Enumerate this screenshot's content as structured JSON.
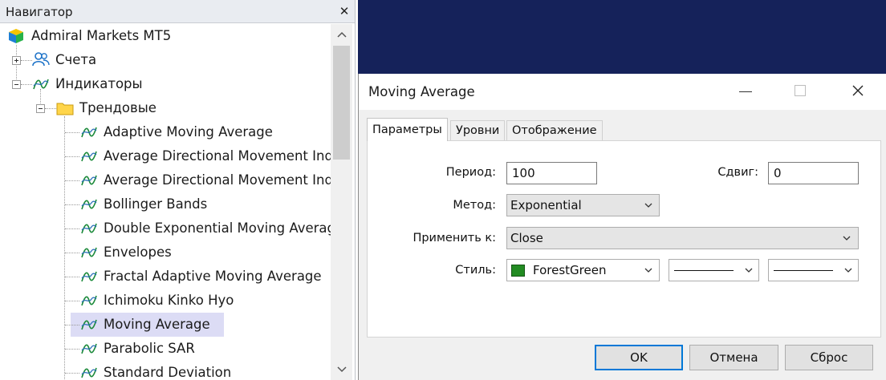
{
  "navigator": {
    "title": "Навигатор",
    "close_glyph": "✕",
    "root": {
      "label": "Admiral Markets MT5",
      "icon": "admiral-logo-icon"
    },
    "accounts": {
      "label": "Счета",
      "icon": "accounts-icon"
    },
    "indicators": {
      "label": "Индикаторы",
      "icon": "indicator-icon"
    },
    "trend_folder": {
      "label": "Трендовые",
      "icon": "folder-icon"
    },
    "items": [
      {
        "label": "Adaptive Moving Average"
      },
      {
        "label": "Average Directional Movement Inde"
      },
      {
        "label": "Average Directional Movement Inde"
      },
      {
        "label": "Bollinger Bands"
      },
      {
        "label": "Double Exponential Moving Average"
      },
      {
        "label": "Envelopes"
      },
      {
        "label": "Fractal Adaptive Moving Average"
      },
      {
        "label": "Ichimoku Kinko Hyo"
      },
      {
        "label": "Moving Average"
      },
      {
        "label": "Parabolic SAR"
      },
      {
        "label": "Standard Deviation"
      }
    ],
    "selected_item": "Moving Average"
  },
  "dialog": {
    "title": "Moving Average",
    "tabs": [
      {
        "label": "Параметры",
        "active": true
      },
      {
        "label": "Уровни",
        "active": false
      },
      {
        "label": "Отображение",
        "active": false
      }
    ],
    "fields": {
      "period_label": "Период:",
      "period_value": "100",
      "shift_label": "Сдвиг:",
      "shift_value": "0",
      "method_label": "Метод:",
      "method_value": "Exponential",
      "apply_label": "Применить к:",
      "apply_value": "Close",
      "style_label": "Стиль:",
      "color_name": "ForestGreen",
      "color_hex": "#228b22"
    },
    "buttons": {
      "ok": "OK",
      "cancel": "Отмена",
      "reset": "Сброс"
    }
  },
  "colors": {
    "chart_background": "#15225a",
    "selection": "#dcdcf5",
    "accent": "#0078d7"
  }
}
